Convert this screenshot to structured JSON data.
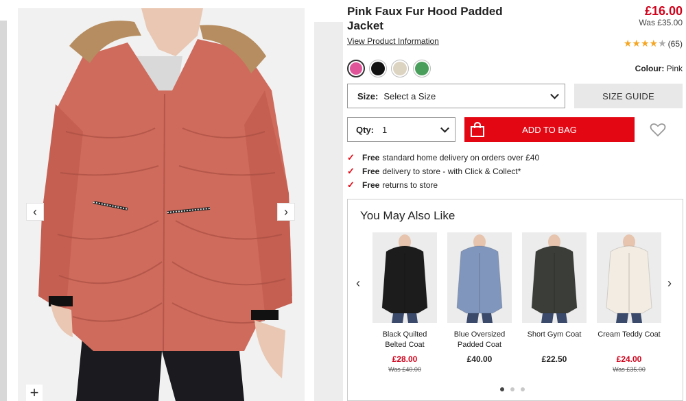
{
  "gallery": {
    "prev_icon": "chevron-left-icon",
    "next_icon": "chevron-right-icon",
    "zoom_icon": "plus-icon",
    "prev_glyph": "‹",
    "next_glyph": "›",
    "zoom_glyph": "+"
  },
  "product": {
    "title": "Pink Faux Fur Hood Padded Jacket",
    "price": "£16.00",
    "was_price": "Was £35.00",
    "info_link": "View Product Information",
    "rating": 4,
    "rating_max": 5,
    "review_count": "(65)",
    "colour_label": "Colour:",
    "colour_value": "Pink",
    "swatches": [
      {
        "name": "Pink",
        "color": "#e0559a",
        "selected": true
      },
      {
        "name": "Black",
        "color": "#111111",
        "selected": false
      },
      {
        "name": "Cream",
        "color": "#ddd3c1",
        "selected": false
      },
      {
        "name": "Green",
        "color": "#4a9e5c",
        "selected": false
      }
    ]
  },
  "size": {
    "label": "Size:",
    "value": "Select a Size",
    "guide_button": "SIZE GUIDE"
  },
  "qty": {
    "label": "Qty:",
    "value": "1"
  },
  "cart": {
    "add_button": "ADD TO BAG",
    "bag_icon": "shopping-bag-icon",
    "wishlist_icon": "heart-icon"
  },
  "delivery": [
    {
      "bold": "Free",
      "text": "standard home delivery on orders over £40"
    },
    {
      "bold": "Free",
      "text": "delivery to store - with Click & Collect*"
    },
    {
      "bold": "Free",
      "text": "returns to store"
    }
  ],
  "recommendations": {
    "title": "You May Also Like",
    "prev_glyph": "‹",
    "next_glyph": "›",
    "items": [
      {
        "name": "Black Quilted Belted Coat",
        "price": "£28.00",
        "was": "Was £40.00",
        "sale": true,
        "coat_color": "#1c1c1c"
      },
      {
        "name": "Blue Oversized Padded Coat",
        "price": "£40.00",
        "was": "",
        "sale": false,
        "coat_color": "#8196bd"
      },
      {
        "name": "Short Gym Coat",
        "price": "£22.50",
        "was": "",
        "sale": false,
        "coat_color": "#3a3d38"
      },
      {
        "name": "Cream Teddy Coat",
        "price": "£24.00",
        "was": "Was £35.00",
        "sale": true,
        "coat_color": "#f2ece2"
      }
    ],
    "page_count": 3,
    "active_page": 0
  },
  "colors": {
    "accent_red": "#e30613",
    "price_red": "#d0021b",
    "jacket": "#cf6b5c",
    "star": "#f5a623"
  }
}
